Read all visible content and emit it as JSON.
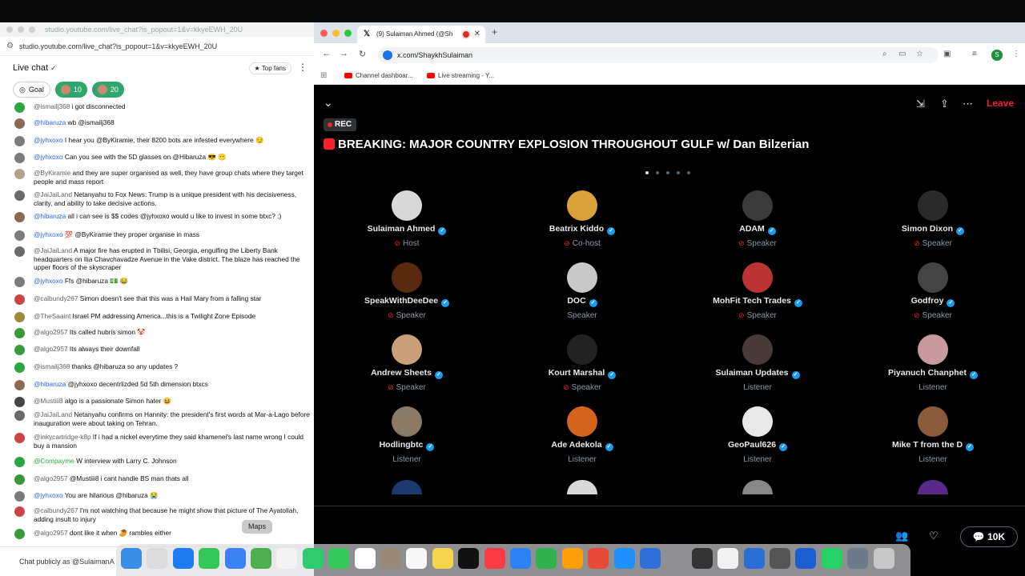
{
  "youtube": {
    "window_title": "studio.youtube.com/live_chat?is_popout=1&v=kkyeEWH_20U",
    "url": "studio.youtube.com/live_chat?is_popout=1&v=kkyeEWH_20U",
    "chat_title": "Live chat",
    "top_fans": "Top fans",
    "goals": [
      {
        "label": "Goal"
      },
      {
        "label": "10"
      },
      {
        "label": "20"
      }
    ],
    "messages": [
      {
        "author": "@ismailj368",
        "text": "i got disconnected",
        "color": "#2ba640",
        "style": "name"
      },
      {
        "author": "@hibaruza",
        "text": "wb @ismailj368",
        "color": "#8a6a55",
        "style": "blue"
      },
      {
        "author": "@jyhxoxo",
        "text": "I hear you @ByKiramie, their 8200 bots are infested everywhere 😏",
        "color": "#7b7b7b",
        "style": "blue"
      },
      {
        "author": "@jyhxoxo",
        "text": "Can you see with the 5D glasses on @Hibaruza 😎 😶",
        "color": "#7b7b7b",
        "style": "blue"
      },
      {
        "author": "@ByKiramie",
        "text": "and they are super organised as well, they have group chats where they target people and mass report",
        "color": "#b5a28a",
        "style": "name"
      },
      {
        "author": "@JaiJaiLand",
        "text": "Netanyahu to Fox News: Trump is a unique president with his decisiveness, clarity, and ability to take decisive actions.",
        "color": "#6a6a6a",
        "style": "name"
      },
      {
        "author": "@hibaruza",
        "text": "all i can see is $$ codes @jyhxoxo would u like to invest in some btxc? :)",
        "color": "#8a6a55",
        "style": "blue"
      },
      {
        "author": "@jyhxoxo",
        "text": "💯 @ByKiramie they proper organise in mass",
        "color": "#7b7b7b",
        "style": "blue"
      },
      {
        "author": "@JaiJaiLand",
        "text": "A major fire has erupted in Tbilisi, Georgia, engulfing the Liberty Bank headquarters on Ilia Chavchavadze Avenue in the Vake district. The blaze has reached the upper floors of the skyscraper",
        "color": "#6a6a6a",
        "style": "name"
      },
      {
        "author": "@jyhxoxo",
        "text": "Ffs @hibaruza 💵 😂",
        "color": "#7b7b7b",
        "style": "blue"
      },
      {
        "author": "@calbundy267",
        "text": "Simon doesn't see that this was a Hail Mary from a falling star",
        "color": "#c44",
        "style": "name"
      },
      {
        "author": "@TheSaaint",
        "text": "Israel PM addressing America...this is a Twilight Zone Episode",
        "color": "#9a8a3a",
        "style": "name"
      },
      {
        "author": "@algo2957",
        "text": "Its called hubris simon 🤡",
        "color": "#3a9a3a",
        "style": "name"
      },
      {
        "author": "@algo2957",
        "text": "Its always their downfall",
        "color": "#3a9a3a",
        "style": "name"
      },
      {
        "author": "@ismailj368",
        "text": "thanks @hibaruza so any updates ?",
        "color": "#2ba640",
        "style": "name"
      },
      {
        "author": "@hibaruza",
        "text": "@jyhxoxo decentrlizded 5d 5th dimension btxcs",
        "color": "#8a6a55",
        "style": "blue"
      },
      {
        "author": "@Mustiii8",
        "text": "algo is a passionate Simon hater 😆",
        "color": "#444",
        "style": "name"
      },
      {
        "author": "@JaiJaiLand",
        "text": "Netanyahu confirms on Hannity: the president's first words at Mar-a-Lago before inauguration were about taking on Tehran.",
        "color": "#6a6a6a",
        "style": "name"
      },
      {
        "author": "@inkycartridge-k8p",
        "text": "If i had a nickel everytime they said khamenei's last name wrong I could buy a mansion",
        "color": "#c44",
        "style": "name"
      },
      {
        "author": "@Compayme",
        "text": "W interview with Larry C. Johnson",
        "color": "#2ba640",
        "style": "green"
      },
      {
        "author": "@algo2957",
        "text": "@Mustiii8 i cant handle BS man thats all",
        "color": "#3a9a3a",
        "style": "name"
      },
      {
        "author": "@jyhxoxo",
        "text": "You are hilarious @hibaruza 😭",
        "color": "#7b7b7b",
        "style": "blue"
      },
      {
        "author": "@calbundy267",
        "text": "I'm not watching that because he might show that picture of The Ayatollah, adding insult to injury",
        "color": "#c44",
        "style": "name"
      },
      {
        "author": "@algo2957",
        "text": "dont like it when 🥭 rambles either",
        "color": "#3a9a3a",
        "style": "name"
      }
    ],
    "input_placeholder": "Chat publicly as @SulaimanA"
  },
  "browser": {
    "tab_title": "(9) Sulaiman Ahmed (@Sh",
    "url": "x.com/ShaykhSulaiman",
    "bookmarks": [
      "Channel dashboar...",
      "Live streaming - Y..."
    ],
    "profile_initial": "S"
  },
  "space": {
    "rec_label": "REC",
    "title": "BREAKING: MAJOR COUNTRY EXPLOSION THROUGHOUT GULF w/ Dan Bilzerian",
    "leave_label": "Leave",
    "listener_count": "10K",
    "participants": [
      {
        "name": "Sulaiman Ahmed",
        "role": "Host",
        "mic": true,
        "color": "#d8d8d8"
      },
      {
        "name": "Beatrix Kiddo",
        "role": "Co-host",
        "mic": true,
        "color": "#d9a13a"
      },
      {
        "name": "ADAM",
        "role": "Speaker",
        "mic": true,
        "color": "#3a3a3a"
      },
      {
        "name": "Simon Dixon",
        "role": "Speaker",
        "mic": true,
        "color": "#2a2a2a"
      },
      {
        "name": "SpeakWithDeeDee",
        "role": "Speaker",
        "mic": true,
        "color": "#5a2a10"
      },
      {
        "name": "DOC",
        "role": "Speaker",
        "mic": false,
        "color": "#c8c8c8"
      },
      {
        "name": "MohFit Tech Trades",
        "role": "Speaker",
        "mic": true,
        "color": "#b33"
      },
      {
        "name": "Godfroy",
        "role": "Speaker",
        "mic": true,
        "color": "#444"
      },
      {
        "name": "Andrew Sheets",
        "role": "Speaker",
        "mic": true,
        "color": "#c9a07a"
      },
      {
        "name": "Kourt Marshal",
        "role": "Speaker",
        "mic": true,
        "color": "#222"
      },
      {
        "name": "Sulaiman Updates",
        "role": "Listener",
        "mic": false,
        "color": "#4a3a3a"
      },
      {
        "name": "Piyanuch Chanphet",
        "role": "Listener",
        "mic": false,
        "color": "#c79aa0"
      },
      {
        "name": "Hodlingbtc",
        "role": "Listener",
        "mic": false,
        "color": "#8a7a66"
      },
      {
        "name": "Ade Adekola",
        "role": "Listener",
        "mic": false,
        "color": "#d4641c"
      },
      {
        "name": "GeoPaul626",
        "role": "Listener",
        "mic": false,
        "color": "#e8e8e8"
      },
      {
        "name": "Mike T from the D",
        "role": "Listener",
        "mic": false,
        "color": "#8a5a3a"
      }
    ]
  },
  "dock": {
    "tooltip": "Maps"
  }
}
